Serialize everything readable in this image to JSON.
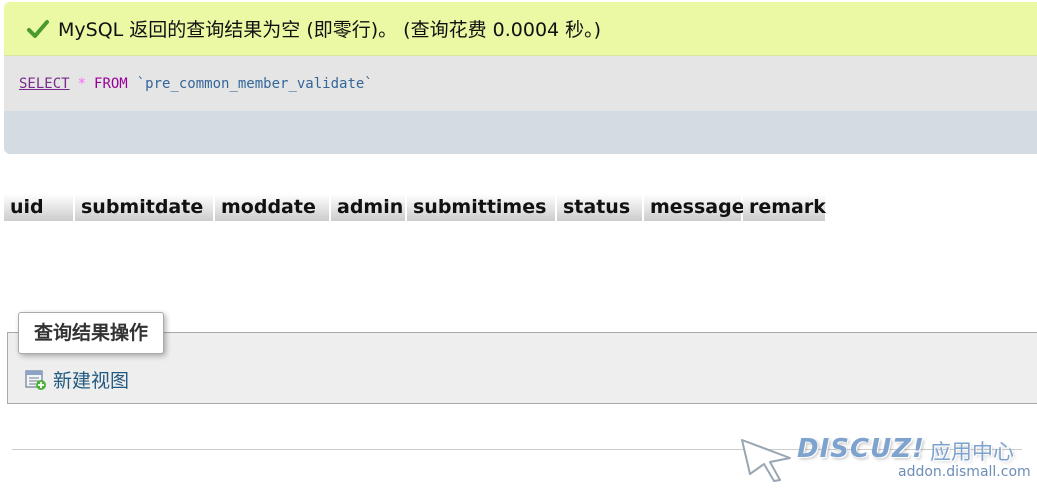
{
  "result": {
    "message": "MySQL 返回的查询结果为空 (即零行)。 (查询花费 0.0004 秒。)",
    "sql": {
      "select": "SELECT",
      "star": "*",
      "from": "FROM",
      "table": "`pre_common_member_validate`"
    }
  },
  "columns": [
    "uid",
    "submitdate",
    "moddate",
    "admin",
    "submittimes",
    "status",
    "message",
    "remark"
  ],
  "operations": {
    "legend": "查询结果操作",
    "create_view": "新建视图"
  },
  "watermark": {
    "brand": "DISCUZ!",
    "suffix": "应用中心",
    "url": "addon.dismall.com"
  },
  "colors": {
    "success_bg": "#ebf8a4",
    "sql_bg": "#e5e5e5",
    "panel_bg": "#d3dce3",
    "link": "#235a81"
  }
}
